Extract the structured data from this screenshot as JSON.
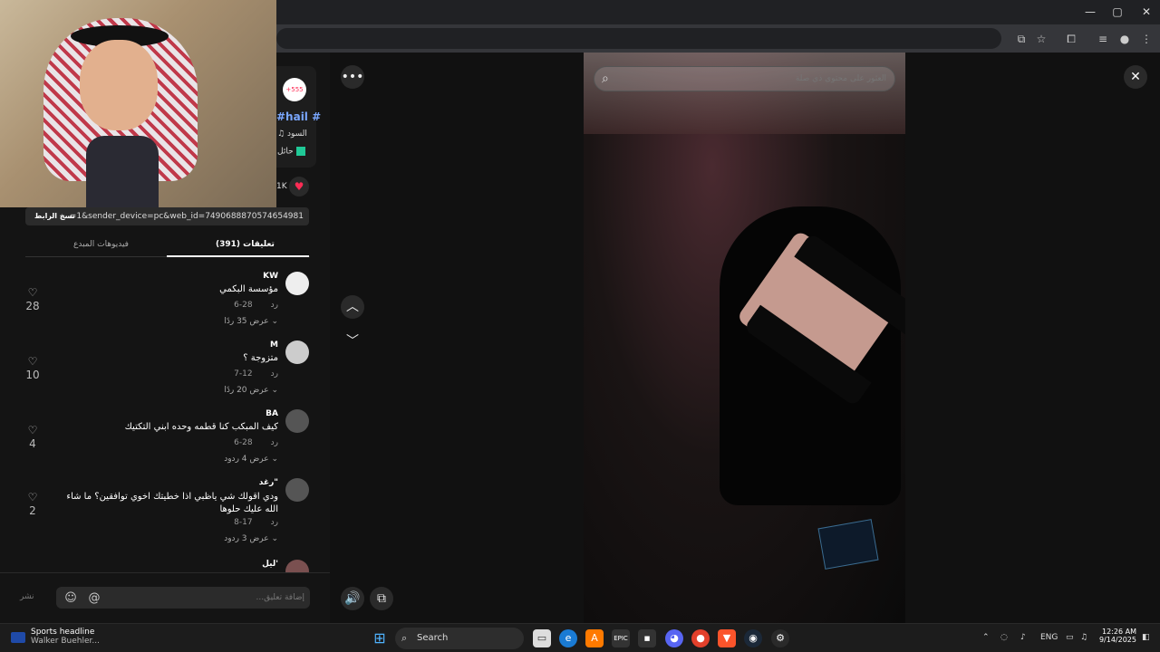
{
  "browser": {
    "win_minimize": "—",
    "win_maximize": "▢",
    "win_close": "✕",
    "toolbar_icons": [
      "install-icon",
      "star-icon",
      "extensions-icon",
      "media-icon",
      "profile-icon",
      "menu-icon"
    ]
  },
  "creator": {
    "avatar_text": "+555",
    "hashtag": "#hail #",
    "music": "♫ السود",
    "label": "حائل",
    "likes": "1K"
  },
  "share": {
    "link": "...=1&sender_device=pc&web_id=7490688870574654981",
    "copy_label": "نسخ الرابط"
  },
  "tabs": {
    "comments": "(391) تعليقات",
    "creator_videos": "فيديوهات المبدع"
  },
  "comments": [
    {
      "name": "KW",
      "text": "مؤسسة البكمي",
      "date": "6-28",
      "reply": "رد",
      "view_replies": "عرض 35 ردًا ⌄",
      "likes": "28"
    },
    {
      "name": "M",
      "text": "متزوجة ؟",
      "date": "7-12",
      "reply": "رد",
      "view_replies": "عرض 20 ردًا ⌄",
      "likes": "10"
    },
    {
      "name": "BA",
      "text": "كيف المبكب كنا قطمه وحده ابني التكتيك",
      "date": "6-28",
      "reply": "رد",
      "view_replies": "عرض 4 ردود ⌄",
      "likes": "4"
    },
    {
      "name": "رغد\"",
      "text": "ودي اقولك شي ياظبي اذا خطيتك اخوي توافقين؟ ما شاء الله عليك حلوها",
      "date": "8-17",
      "reply": "رد",
      "view_replies": "عرض 3 ردود ⌄",
      "likes": "2"
    },
    {
      "name": "ليل'"
    }
  ],
  "composer": {
    "placeholder": "إضافة تعليق...",
    "post_label": "نشر"
  },
  "search": {
    "placeholder": "العثور على محتوى ذي صلة"
  },
  "taskbar": {
    "news_title": "Sports headline",
    "news_sub": "Walker Buehler...",
    "search_label": "Search",
    "lang": "ENG",
    "time": "12:26 AM",
    "date": "9/14/2025"
  },
  "colors": {
    "accent": "#fe2c55",
    "hashtag": "#7aa7ff"
  }
}
